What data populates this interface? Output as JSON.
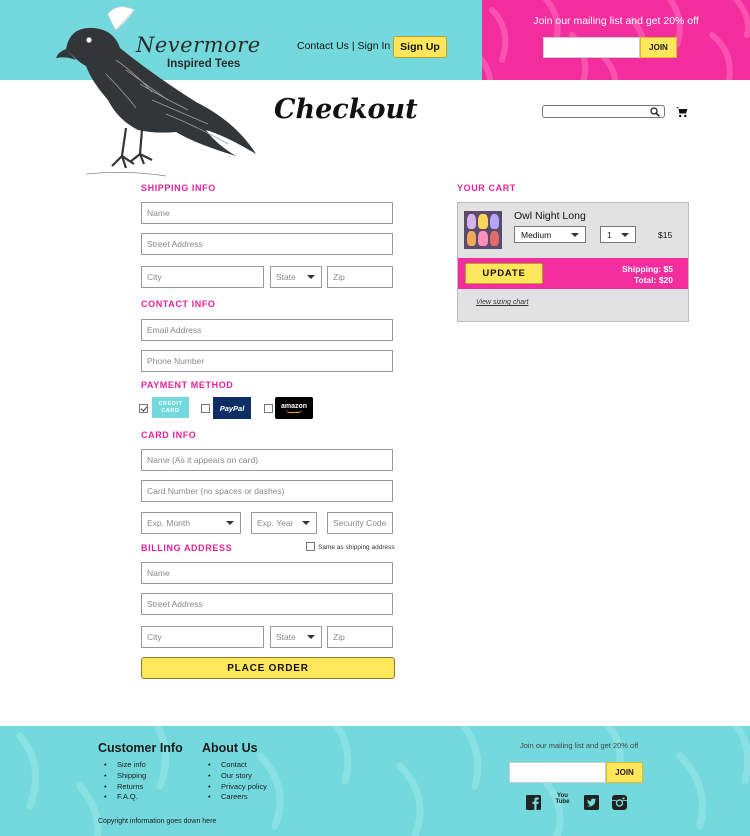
{
  "header": {
    "brand_name": "Nevermore",
    "brand_tagline": "Inspired Tees",
    "nav_contact": "Contact Us",
    "nav_separator": "|",
    "nav_signin": "Sign In",
    "signup_label": "Sign Up",
    "promo_text": "Join our mailing list and get 20% off",
    "promo_join_label": "JOIN"
  },
  "page": {
    "title": "Checkout"
  },
  "shipping": {
    "heading": "SHIPPING INFO",
    "name_ph": "Name",
    "street_ph": "Street Address",
    "city_ph": "City",
    "state_ph": "State",
    "zip_ph": "Zip"
  },
  "contact": {
    "heading": "CONTACT INFO",
    "email_ph": "Email Address",
    "phone_ph": "Phone Number"
  },
  "payment": {
    "heading": "PAYMENT METHOD",
    "credit_line1": "CREDIT",
    "credit_line2": "CARD",
    "paypal_label": "PayPal",
    "amazon_label": "amazon"
  },
  "card": {
    "heading": "CARD INFO",
    "name_ph": "Name (As it appears on card)",
    "number_ph": "Card Number (no spaces or dashes)",
    "month_ph": "Exp. Month",
    "year_ph": "Exp. Year",
    "cvv_ph": "Security Code"
  },
  "billing": {
    "heading": "BILLING ADDRESS",
    "same_label": "Same as shipping address",
    "name_ph": "Name",
    "street_ph": "Street Address",
    "city_ph": "City",
    "state_ph": "State",
    "zip_ph": "Zip"
  },
  "place_order_label": "PLACE ORDER",
  "cart": {
    "heading": "YOUR CART",
    "item_name": "Owl Night Long",
    "size": "Medium",
    "quantity": "1",
    "price": "$15",
    "update_label": "UPDATE",
    "shipping_line": "Shipping: $5",
    "total_line": "Total: $20",
    "sizing_link": "View sizing chart"
  },
  "footer": {
    "col1_heading": "Customer Info",
    "col1_items": [
      "Size info",
      "Shipping",
      "Returns",
      "F.A.Q."
    ],
    "col2_heading": "About Us",
    "col2_items": [
      "Contact",
      "Our story",
      "Privacy policy",
      "Careers"
    ],
    "promo_text": "Join our mailing list and get 20% off",
    "join_label": "JOIN",
    "youtube_text": "You Tube",
    "copyright": "Copyright information goes down here"
  },
  "colors": {
    "teal": "#74d9dc",
    "pink": "#f42d9e",
    "yellow": "#ffe65a"
  },
  "icons": [
    "search-icon",
    "cart-icon",
    "facebook-icon",
    "youtube-icon",
    "twitter-icon",
    "instagram-icon",
    "raven-logo-icon"
  ]
}
